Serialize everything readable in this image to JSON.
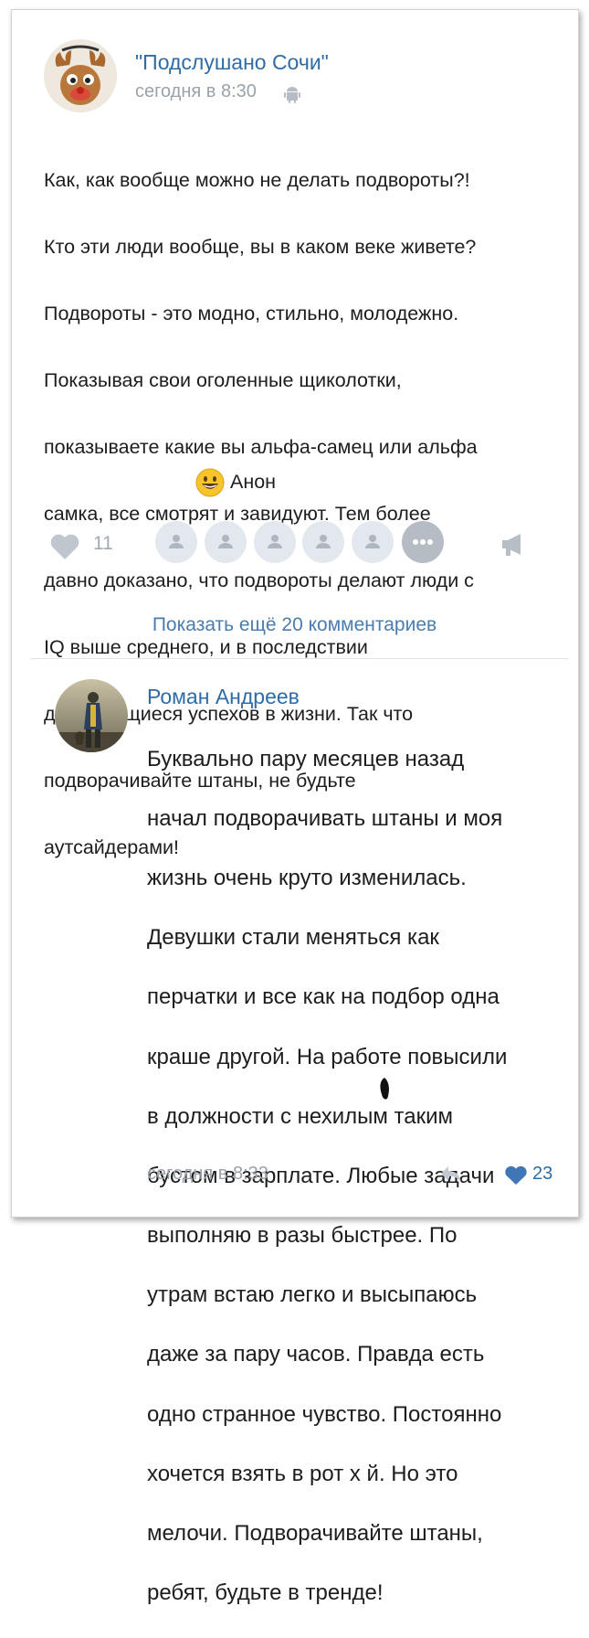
{
  "post": {
    "group_name": "\"Подслушано Сочи\"",
    "time": "сегодня в 8:30",
    "text_lines": [
      "Как, как вообще можно не делать подвороты?!",
      "Кто эти люди вообще, вы в каком веке живете?",
      "Подвороты - это модно, стильно, молодежно.",
      "Показывая свои оголенные щиколотки,",
      "показываете какие вы альфа-самец или альфа",
      "самка, все смотрят и завидуют. Тем более",
      "давно доказано, что подвороты делают люди с",
      "IQ выше среднего, и в последствии",
      "добивающиеся успехов в жизни. Так что",
      "подворачивайте штаны, не будьте",
      "аутсайдерами!"
    ],
    "signature": "Анон",
    "likes": "11",
    "show_more_comments": "Показать ещё 20 комментариев"
  },
  "comment": {
    "author": "Роман Андреев",
    "text_lines": [
      "Буквально пару месяцев назад",
      "начал подворачивать штаны и моя",
      "жизнь очень круто изменилась.",
      "Девушки стали меняться как",
      "перчатки и все как на подбор одна",
      "краше другой. На работе повысили",
      "в должности с нехилым таким",
      "бустом в зарплате. Любые задачи",
      "выполняю в разы быстрее. По",
      "утрам встаю легко и высыпаюсь",
      "даже за пару часов. Правда есть",
      "одно странное чувство. Постоянно",
      "хочется взять в рот х й. Но это",
      "мелочи. Подворачивайте штаны,",
      "ребят, будьте в тренде!"
    ],
    "time": "сегодня в 8:33",
    "likes": "23"
  },
  "colors": {
    "link": "#2f6ca5",
    "meta": "#9aa2aa",
    "text": "#1d1d1d"
  },
  "icons": [
    "android-icon",
    "heart-icon",
    "share-megaphone-icon",
    "reply-icon",
    "smile-emoji-icon"
  ]
}
